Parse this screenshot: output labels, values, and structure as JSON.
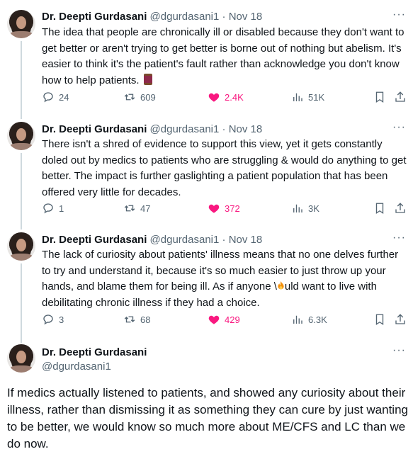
{
  "author": {
    "name": "Dr. Deepti Gurdasani",
    "handle": "@dgurdasani1"
  },
  "separator": "·",
  "more_label": "···",
  "tweets": [
    {
      "date": "Nov 18",
      "text": "The idea that people are chronically ill or disabled because they don't want to get better or aren't trying to get better is borne out of nothing but abelism. It's easier to think it's the patient's fault rather than acknowledge you don't know how to help patients.",
      "emoji": "spool-of-thread",
      "replies": "24",
      "retweets": "609",
      "likes": "2.4K",
      "views": "51K"
    },
    {
      "date": "Nov 18",
      "text": "There isn't a shred of evidence to support this view, yet it gets constantly doled out by medics to patients who are struggling & would do anything to get better. The impact is further gaslighting a patient population that has been offered very little for decades.",
      "replies": "1",
      "retweets": "47",
      "likes": "372",
      "views": "3K"
    },
    {
      "date": "Nov 18",
      "text_before": "The lack of curiosity about patients' illness means that no one delves further to try and understand it, because it's so much easier to just throw up your hands, and blame them for being ill. As if anyone \\",
      "text_after": "uld want to live with debilitating chronic illness if they had a choice.",
      "replies": "3",
      "retweets": "68",
      "likes": "429",
      "views": "6.3K"
    }
  ],
  "main_tweet": {
    "text": "If medics actually listened to patients, and showed any curiosity about their illness, rather than dismissing it as something they can cure by just wanting to be better, we would know so much more about ME/CFS and LC than we do now."
  },
  "colors": {
    "text": "#0f1419",
    "secondary": "#536471",
    "like_active": "#f91880",
    "thread_line": "#cfd9de"
  }
}
